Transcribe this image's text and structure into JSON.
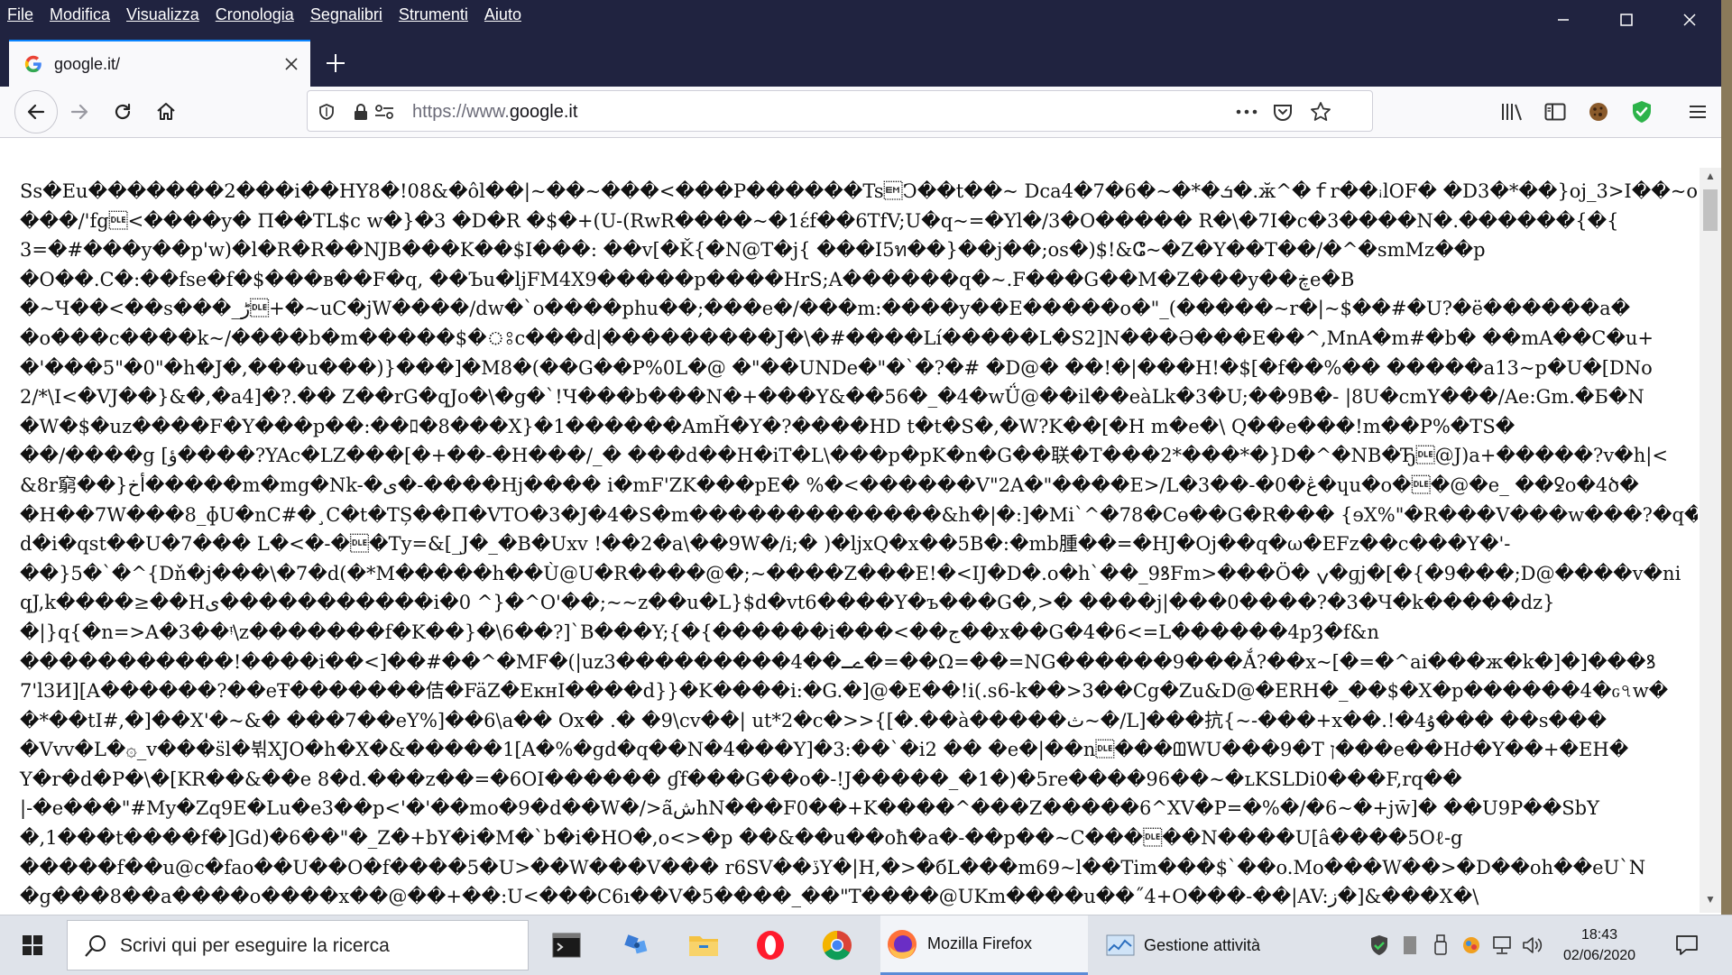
{
  "menu": [
    "File",
    "Modifica",
    "Visualizza",
    "Cronologia",
    "Segnalibri",
    "Strumenti",
    "Aiuto"
  ],
  "tab": {
    "title": "google.it/"
  },
  "url": {
    "scheme": "https://www.",
    "host": "google.it"
  },
  "content_lines": [
    "Ss�Eu�������2���i��HY8�!08&�ôl��|~��~���<���P������Ts\u0019Ͻ��t��~ Dca4�7�6�~�*�ܭ�.ӂ^�ｆr��ꜟlOF� �D3�*��}oj_3>I��~o�",
    "���/'fg\u0010<����y� Π��TL$c w�}�3 �D�R �$�+(U-(RwR����~�1έf��6TfV;U�q~=�Yl�/3�O����� R�\\�7I�c�3����N�.������{�{",
    "3=�#���y��p'w)�l�R�R��NJB���K��$I���: ��v[�Ǩ{�N@T�j{ ���I5ท��}��j��;os�)$!&ⵛ~�Z�Y��T��/�^�smMz��p",
    "�O��.C�:��fse�f�$���в��F�q, ��Ъu�ljFM4X9�����p����HrS;A������q�~.F���G��M�Z���y��ڿe�B",
    "�~Ч��<��s���_ڑ\u0010+�~uC�jW����/dw�`o����phu��;���e�/���m:����y��E�����o�\"_(�����~r�|~$��#�U?�ë������a�",
    "�o���c����k~/����b�m�����$�ঃc���d|���������J�\\�#����Lí�����L�S2]N���Ə���E��^,MnA�m#�b� ��mA��C�u+",
    "�'���5\"�0\"�h�J�,���u���)}���]�M8�(��G��P%0L�@ �\"��UNDe�\"�`�?�# �D@� ��!�|���H!�$[�f��%�� �����a13~p�U�[DNo",
    "2/*\\I<�VJ��}&�,�a4]�?.�� Z��rG�qJo�\\�g�`!Ч���b���N�+���Y&��56�_�4�wǗ@��il��eàLk�3�U;��9B�- |8U�cmY���/Ae:Gm.�Б�N",
    "�W�$�uz����F�Y���p��:��ﾛ�8���X}�1������AmȞ�Y�?����HD t�t�S�,�W?K��[�H m�e�\\ Q��e���!m��P%�TS�",
    "��/����g [ؤ����?YAc�LZ���[�+��-�H���/_� ���d��H�iT�L\\���p�pK�n�G��联�T���2*���*�}D�^�NB�Ђ\u0010@J)a+�����?v�h|<",
    "&8r窮��}أخ�����m�mg�Nk-�ى�-����Hj���� i�mF'ZK���pE� %�<������V\"2A�\"����E>/L�3��-�0�ڠ�ɥu�o�\u0010�@�e_ ��ꝿo�4ծ�",
    "�H��7W���8_ɸU�nC#�¸C�t�TȘ��Π�VTO�3�J�4�S�m�������������&h�|�:]�Mi`^�78�Cɵ��G�R��� {ɘX%\"�R���V���w���?�q�",
    "d�i�qst��U�7��� L�<�-�\u0010�Ty=&[_J�_�B�Uxv !��2�a\\��9W�/i;� )�ljxQ�x��5B�:�mb腫��=�HJ�Oj��q�ω�EFz��c���Y�'-",
    "��}5�`�^{Dň�j���\\�7�d(�*M�����h��Ù@U�R����@�;~����Z���E!�<IJ�D�.o�h`��_9ꝸFm>���Ö� ݍ�ɡj�[�{�9���;D@����v�ni",
    "qJ,k����≥��Hى�����������i�0 ^}�^O'��;~~z��u�L}$d�vt6����Y�ъ���G�,>� ����j|���0����?�3�Ч�k�����dz}",
    "�|}q{�n=>A�3��ᵎ\\z�������f�K��}�\\6��?]`B���Y;{�{������i���<��ج��x��G�4�6<=L������4pȜ�f&n",
    "�����������!����i��<]��#��^�MF�(|uz3���������4��ےـ�=��Ω=��=NG������9���Ắ?��x~[�=�^ai���ж�k�]�]���ꝸ",
    "7'l3И][A������?��eŦ�������佶�FäZ�EĸнI����d}}�K����i:�G.�]@�E��!i(.s6-k��>3��Cg�Zu&D@�ERH�_��$�X�p������4�ԍ৭w�",
    "�*��tI#,�]��X'�~&� ���7��eY%]��6\\a�� Ox� .� �9\\cv��| ut*2�c�>>{[�.��à�����ث~�/L]���抗{~-���+x��.!�4ۇ��� ��s���",
    "�Vvv�L�۞_v���s̈l�뷖XJO�h�X�&�����1[A�%�gd�q��N�4���Y]�3:��`�i2 �� �e�|��n\u0010���ᗶWU���9�T ן���e��Hժ�Y��+�EH�",
    "Y�r�d�P�\\�[KR��&��e 8�d.���z��=�6OI������ ɠf���G��o�-!J�����_�1�)�5re����96��~�ʟKSLDi0���F,rq��",
    "|-�e���\"#My�Zq9E�Lu�e3��p<'�'��mo�9�d��W�/>aش̃hN���F0��+K����^���Z�����6^XV�P=�%�/�6~�+jw̄]� ��U9P��SbY",
    "�,1���t����f�]Gd)�6��\"�_Z�+bY�i�M�`b�i�HO�,o<>�p ��&��u��oħ�a�-��p��~C���\u0010��N����U[â����5Oℓ-g",
    "�����f��u@c�fao��U��O�f����5�U>��W���V��� r6SV��ڏY�|H,�>�бL���m69~l��Tim���$`��o.Mo���W��>�D��oh��eU`N",
    "�g���8��a����o����x��@��+��:U<���C6ı��V�5����_��\"T����@UKm����u��˝4+O���-��|AV:ز�]&���X�\\"
  ],
  "search": {
    "placeholder": "Scrivi qui per eseguire la ricerca"
  },
  "taskbar": {
    "apps": [
      {
        "label": "Mozilla Firefox",
        "icon": "firefox-icon"
      },
      {
        "label": "Gestione attività",
        "icon": "task-manager-icon"
      }
    ]
  },
  "clock": {
    "time": "18:43",
    "date": "02/06/2020"
  }
}
